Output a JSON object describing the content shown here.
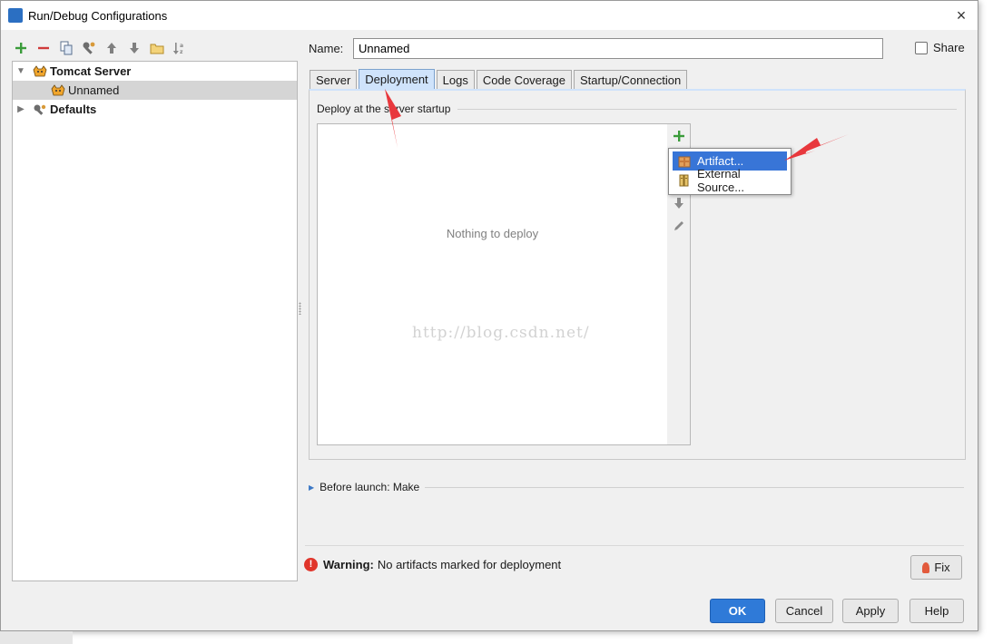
{
  "window": {
    "title": "Run/Debug Configurations",
    "close": "×"
  },
  "tree": {
    "items": [
      {
        "label": "Tomcat Server",
        "level": 0,
        "expanded": true
      },
      {
        "label": "Unnamed",
        "level": 1,
        "selected": true
      },
      {
        "label": "Defaults",
        "level": 0,
        "expanded": false
      }
    ]
  },
  "form": {
    "name_label": "Name:",
    "name_value": "Unnamed",
    "share_label": "Share"
  },
  "tabs": [
    {
      "label": "Server"
    },
    {
      "label": "Deployment",
      "active": true
    },
    {
      "label": "Logs"
    },
    {
      "label": "Code Coverage"
    },
    {
      "label": "Startup/Connection"
    }
  ],
  "deployment": {
    "section_title": "Deploy at the server startup",
    "empty_text": "Nothing to deploy",
    "watermark": "http://blog.csdn.net/"
  },
  "popup": {
    "items": [
      {
        "label": "Artifact...",
        "icon": "artifact-icon",
        "highlighted": true
      },
      {
        "label": "External Source...",
        "icon": "external-source-icon"
      }
    ]
  },
  "before_launch": {
    "label": "Before launch: Make"
  },
  "warning": {
    "title": "Warning:",
    "message": "No artifacts marked for deployment",
    "fix_label": "Fix"
  },
  "buttons": {
    "ok": "OK",
    "cancel": "Cancel",
    "apply": "Apply",
    "help": "Help"
  },
  "colors": {
    "accent": "#2f7ad8",
    "selection": "#3875d7",
    "tab_active": "#cfe3fb",
    "arrow_red": "#e8383d"
  }
}
